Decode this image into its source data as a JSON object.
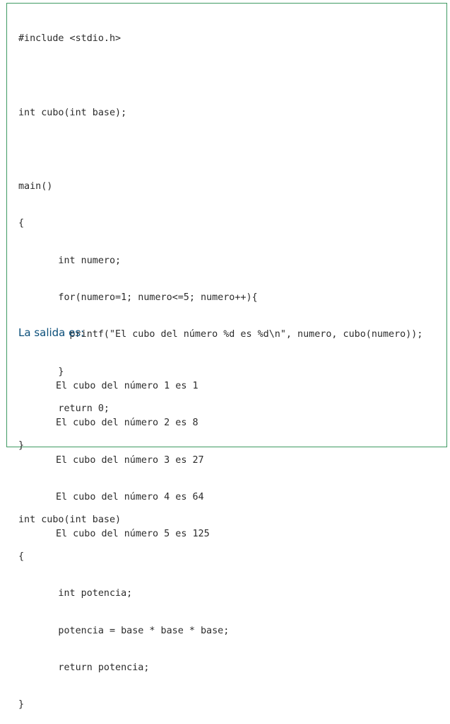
{
  "code_lines": [
    "#include <stdio.h>",
    "",
    "int cubo(int base);",
    "",
    "main()",
    "{",
    "       int numero;",
    "       for(numero=1; numero<=5; numero++){",
    "         printf(\"El cubo del número %d es %d\\n\", numero, cubo(numero));",
    "       }",
    "       return 0;",
    "}",
    "",
    "int cubo(int base)",
    "{",
    "       int potencia;",
    "       potencia = base * base * base;",
    "       return potencia;",
    "}"
  ],
  "output_heading": "La salida es:",
  "output_lines": [
    "El cubo del número 1 es 1",
    "El cubo del número 2 es 8",
    "El cubo del número 3 es 27",
    "El cubo del número 4 es 64",
    "El cubo del número 5 es 125"
  ]
}
